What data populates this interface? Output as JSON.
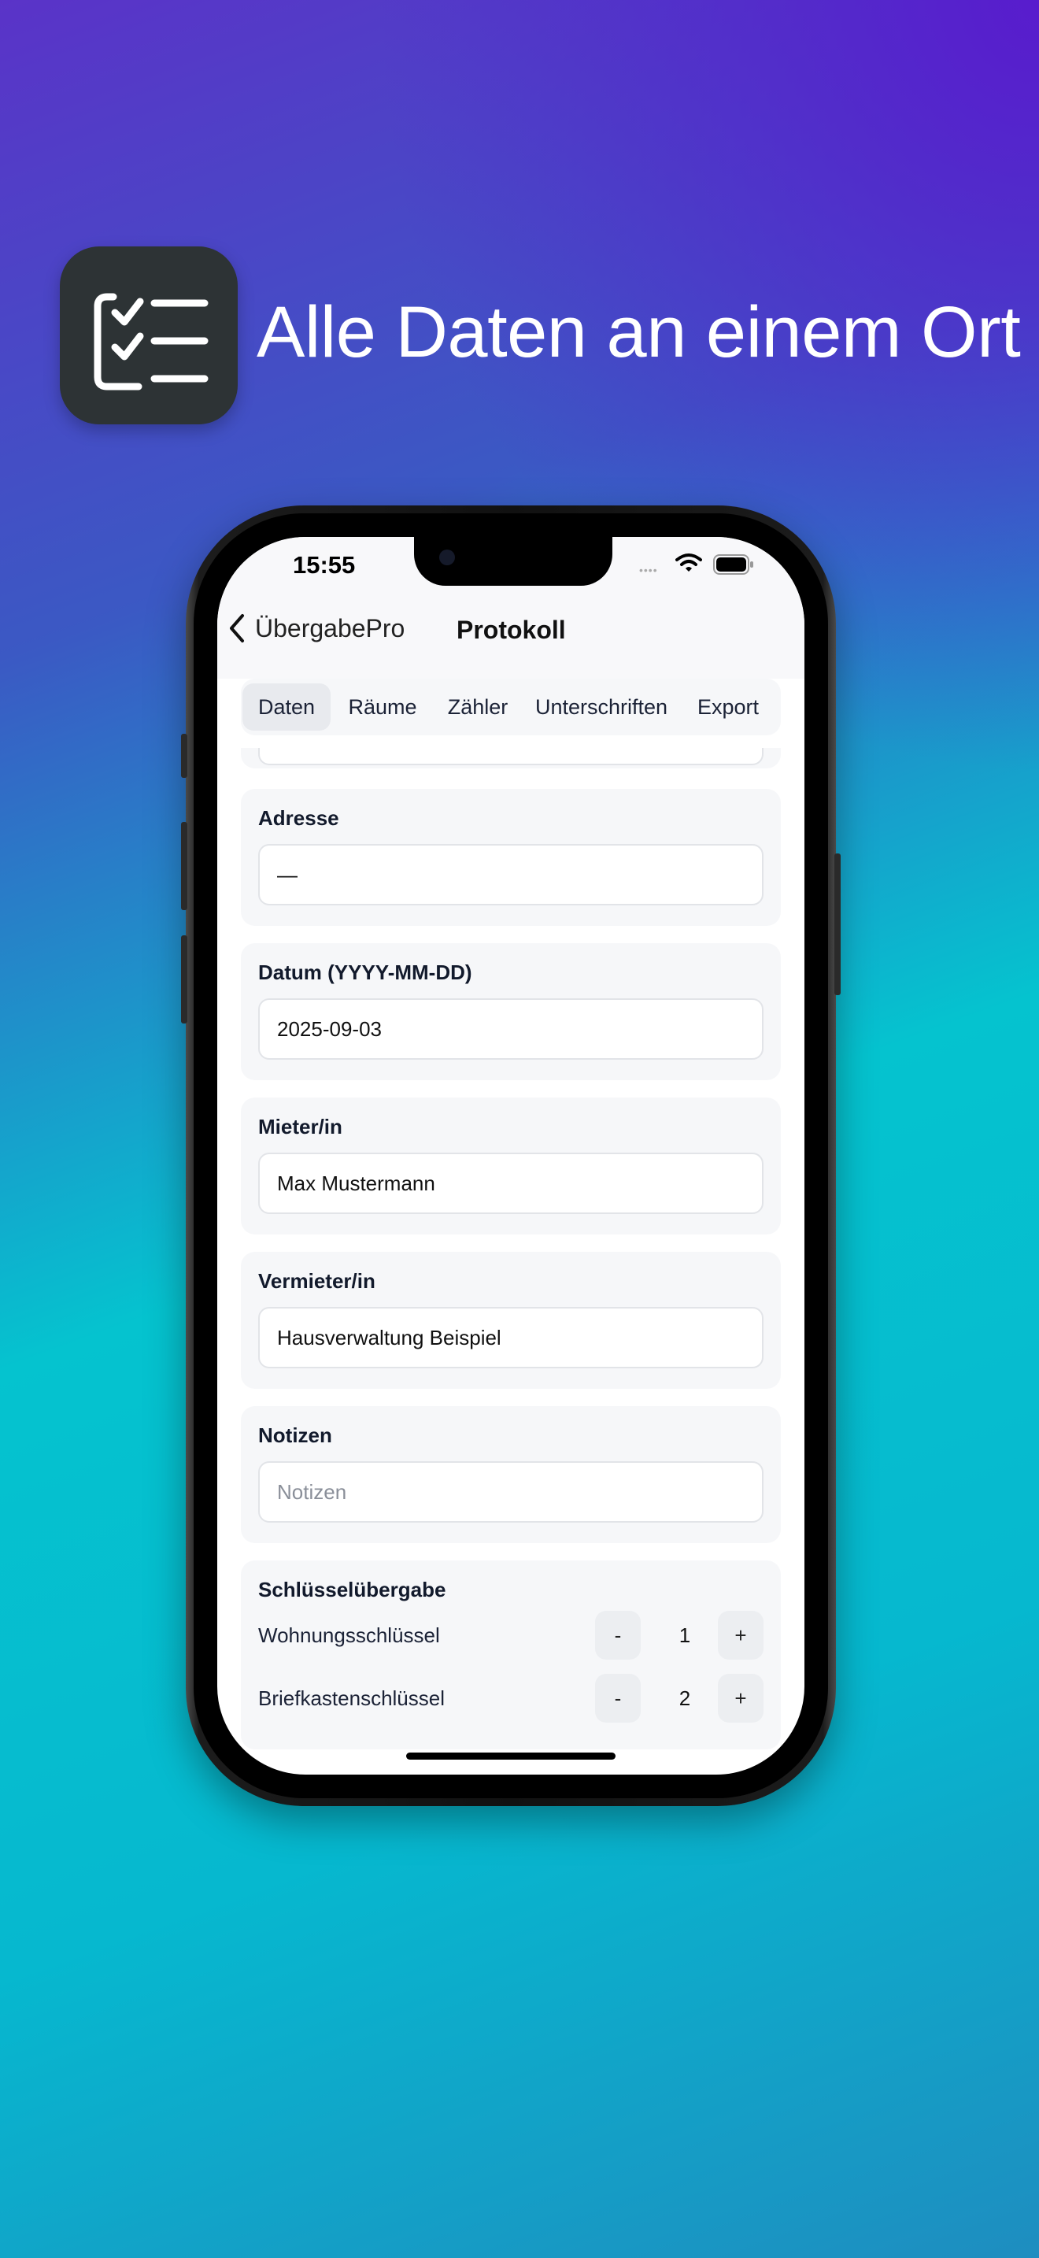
{
  "marketing": {
    "headline": "Alle Daten an einem Ort",
    "app_icon": "checklist-icon",
    "colors": {
      "gradient_top": "#5a33c8",
      "gradient_mid": "#05c3cf",
      "gradient_bottom": "#1e8dc0",
      "icon_bg": "#2d3335"
    }
  },
  "status_bar": {
    "time": "15:55",
    "signal": "••••"
  },
  "nav": {
    "back_label": "ÜbergabePro",
    "title": "Protokoll"
  },
  "tabs": [
    {
      "label": "Daten",
      "active": true
    },
    {
      "label": "Räume",
      "active": false
    },
    {
      "label": "Zähler",
      "active": false
    },
    {
      "label": "Unterschriften",
      "active": false
    },
    {
      "label": "Export",
      "active": false
    }
  ],
  "form": {
    "address": {
      "label": "Adresse",
      "value": "—"
    },
    "date": {
      "label": "Datum (YYYY-MM-DD)",
      "value": "2025-09-03"
    },
    "tenant": {
      "label": "Mieter/in",
      "value": "Max Mustermann"
    },
    "landlord": {
      "label": "Vermieter/in",
      "value": "Hausverwaltung Beispiel"
    },
    "notes": {
      "label": "Notizen",
      "placeholder": "Notizen"
    }
  },
  "keys": {
    "title": "Schlüsselübergabe",
    "minus_label": "-",
    "plus_label": "+",
    "items": [
      {
        "label": "Wohnungsschlüssel",
        "count": "1"
      },
      {
        "label": "Briefkastenschlüssel",
        "count": "2"
      }
    ]
  }
}
